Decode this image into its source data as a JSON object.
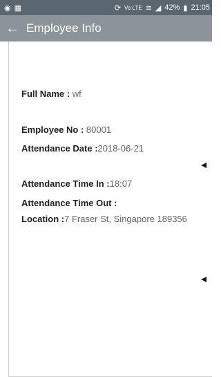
{
  "status_bar": {
    "left_icons": [
      "location-icon",
      "notification-icon"
    ],
    "right_icons": [
      "sync-icon",
      "volte-icon",
      "wifi-icon",
      "signal-icon",
      "battery-icon"
    ],
    "battery_text": "42%",
    "time": "21:05"
  },
  "app_bar": {
    "back_icon": "arrow-left-icon",
    "title": "Employee Info"
  },
  "fields": {
    "full_name": {
      "label": "Full Name : ",
      "value": "wf"
    },
    "employee_no": {
      "label": "Employee No : ",
      "value": "80001"
    },
    "attendance_date": {
      "label": "Attendance Date :",
      "value": "2018-06-21"
    },
    "time_in": {
      "label": "Attendance Time In :",
      "value": "18:07"
    },
    "time_out": {
      "label": "Attendance Time Out :",
      "value": ""
    },
    "location": {
      "label": "Location :",
      "value": "7 Fraser St, Singapore 189356"
    }
  },
  "colors": {
    "status_bar": "#5b6770",
    "app_bar": "#8b949b"
  }
}
